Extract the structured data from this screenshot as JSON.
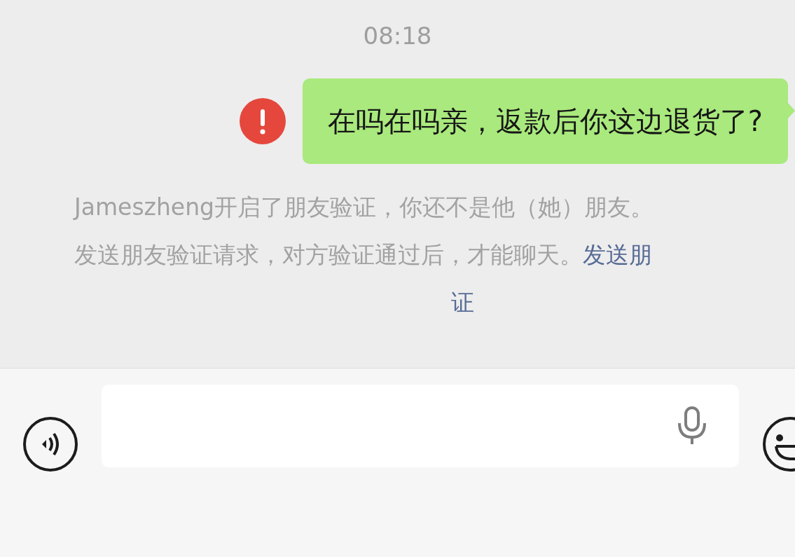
{
  "time": "08:18",
  "messages": [
    {
      "text": "在吗在吗亲，返款后你这边退货了?",
      "outgoing": true,
      "failed": true
    }
  ],
  "notice": {
    "lines": [
      {
        "text": "Jameszheng开启了朋友验证，你还不是他（她）朋友。"
      },
      {
        "text": "发送朋友验证请求，对方验证通过后，才能聊天。",
        "link": "发送朋"
      },
      {
        "link": "证"
      }
    ]
  }
}
